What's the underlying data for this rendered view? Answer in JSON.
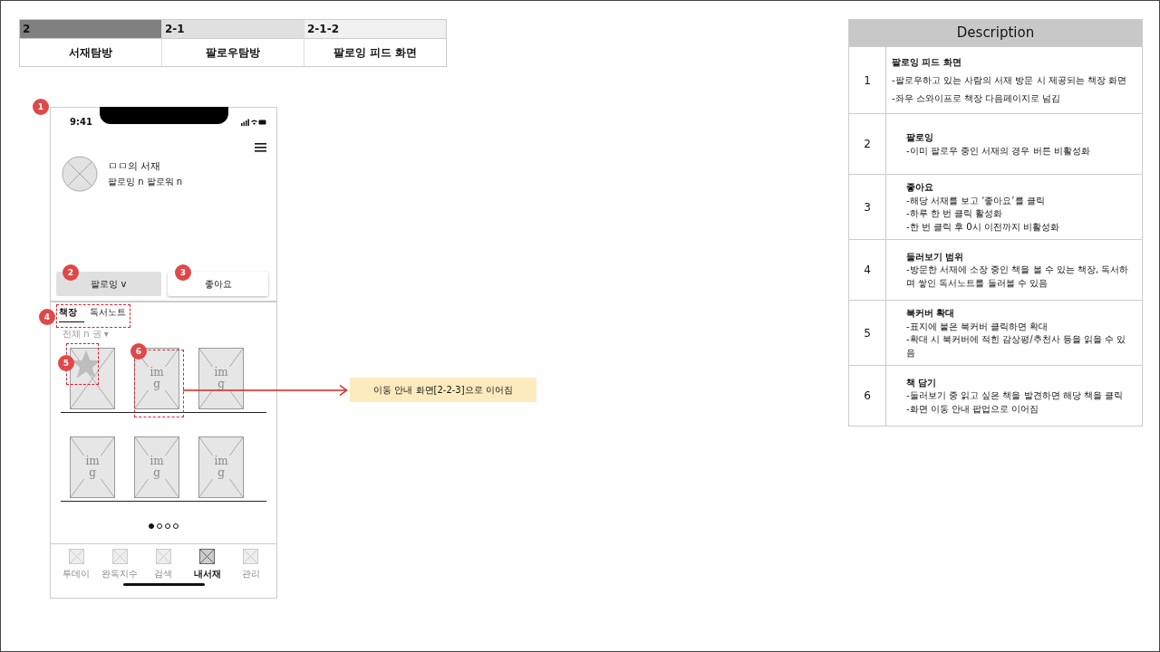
{
  "breadcrumb": [
    {
      "code": "2",
      "label": "서재탐방"
    },
    {
      "code": "2-1",
      "label": "팔로우탐방"
    },
    {
      "code": "2-1-2",
      "label": "팔로잉 피드 화면"
    }
  ],
  "phone": {
    "time": "9:41",
    "library_title": "ㅁㅁ의 서재",
    "follow_stats": "팔로잉 n 팔로워 n",
    "buttons": [
      {
        "label": "팔로잉 v",
        "disabled": true
      },
      {
        "label": "좋아요",
        "disabled": false
      }
    ],
    "tabs": [
      {
        "label": "책장",
        "selected": true
      },
      {
        "label": "독서노트",
        "selected": false
      }
    ],
    "filter": "전체 n 권 ▾",
    "shelves": [
      {
        "books": [
          {
            "cover_badge": true
          },
          {
            "label": "img",
            "cover_badge": false
          },
          {
            "label": "img",
            "cover_badge": false
          }
        ]
      },
      {
        "books": [
          {
            "label": "img",
            "cover_badge": false
          },
          {
            "label": "img",
            "cover_badge": false
          },
          {
            "label": "img",
            "cover_badge": false
          }
        ]
      }
    ],
    "page_dots": [
      {
        "selected": true
      },
      {
        "selected": false
      },
      {
        "selected": false
      },
      {
        "selected": false
      }
    ],
    "nav": [
      {
        "label": "투데이",
        "selected": false
      },
      {
        "label": "완독지수",
        "selected": false
      },
      {
        "label": "검색",
        "selected": false
      },
      {
        "label": "내서재",
        "selected": true
      },
      {
        "label": "관리",
        "selected": false
      }
    ]
  },
  "annotations": [
    "1",
    "2",
    "3",
    "4",
    "5",
    "6"
  ],
  "note": "이동 안내 화면[2-2-3]으로 이어짐",
  "description": {
    "title": "Description",
    "rows": [
      {
        "number": "1",
        "heading": "팔로잉 피드 화면",
        "lines": [
          "-팔로우하고 있는 사람의 서재 방문 시 제공되는 책장 화면",
          "-좌우 스와이프로 책장 다음페이지로 넘김"
        ]
      },
      {
        "number": "2",
        "heading": "팔로잉",
        "lines": [
          "-이미 팔로우 중인 서재의 경우 버튼 비활성화"
        ]
      },
      {
        "number": "3",
        "heading": "좋아요",
        "lines": [
          "-해당 서재를 보고 ‘좋아요’를 클릭",
          "-하루 한 번 클릭 활성화",
          "-한 번 클릭 후 0시 이전까지 비활성화"
        ]
      },
      {
        "number": "4",
        "heading": "둘러보기 범위",
        "lines": [
          "-방문한 서재에 소장 중인 책을 볼 수 있는 책장, 독서하며 쌓인 독서노트를 둘러볼 수 있음"
        ]
      },
      {
        "number": "5",
        "heading": "북커버 확대",
        "lines": [
          "-표지에 붙은 북커버 클릭하면 확대",
          "-확대 시 북커버에 적힌 감상평/추천사 등을 읽을 수 있음"
        ]
      },
      {
        "number": "6",
        "heading": "책 담기",
        "lines": [
          "-둘러보기 중 읽고 싶은 책을 발견하면 해당 책을 클릭",
          "-화면 이동 안내 팝업으로 이어짐"
        ]
      }
    ]
  }
}
